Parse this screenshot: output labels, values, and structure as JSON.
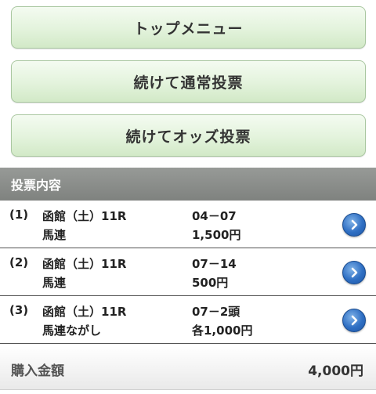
{
  "menu": {
    "top_menu": "トップメニュー",
    "continue_normal": "続けて通常投票",
    "continue_odds": "続けてオッズ投票"
  },
  "section": {
    "title": "投票内容"
  },
  "bets": [
    {
      "num": "(1)",
      "race": "函館（土）11R",
      "type": "馬連",
      "combo": "04－07",
      "amount": "1,500円"
    },
    {
      "num": "(2)",
      "race": "函館（土）11R",
      "type": "馬連",
      "combo": "07－14",
      "amount": "500円"
    },
    {
      "num": "(3)",
      "race": "函館（土）11R",
      "type": "馬連ながし",
      "combo": "07－2頭",
      "amount": "各1,000円"
    }
  ],
  "total": {
    "label": "購入金額",
    "value": "4,000円"
  },
  "icons": {
    "row_arrow": "chevron-right-circle-icon"
  },
  "colors": {
    "button_green": "#e3f3dc",
    "header_gray": "#8b8e8b",
    "arrow_blue": "#2f6fc3"
  }
}
